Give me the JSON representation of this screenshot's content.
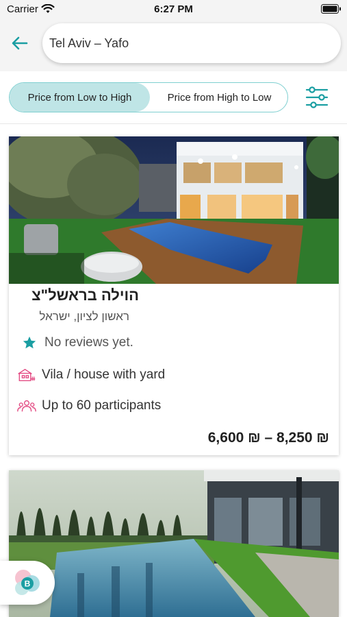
{
  "status_bar": {
    "carrier": "Carrier",
    "time": "6:27 PM"
  },
  "search": {
    "value": "Tel Aviv – Yafo",
    "placeholder": ""
  },
  "sort": {
    "low_to_high": "Price from Low to High",
    "high_to_low": "Price from High to Low",
    "selected": "low_to_high"
  },
  "colors": {
    "accent": "#1a9ea2",
    "accent_light": "#bfe5e6",
    "icon_pink": "#e2457f"
  },
  "listings": [
    {
      "title": "הוילה בראשל\"צ",
      "location": "ראשון לציון, ישראל",
      "rating_icon": "star-icon",
      "reviews": "No reviews yet.",
      "type_icon": "villa-icon",
      "type": "Vila / house with yard",
      "participants_icon": "people-icon",
      "participants": "Up to 60 participants",
      "price": "6,600 ₪ – 8,250 ₪"
    },
    {
      "title": "",
      "location": "",
      "reviews": "",
      "type": "",
      "participants": "",
      "price": ""
    }
  ],
  "fab": {
    "icon": "bot-icon",
    "label": "B"
  }
}
